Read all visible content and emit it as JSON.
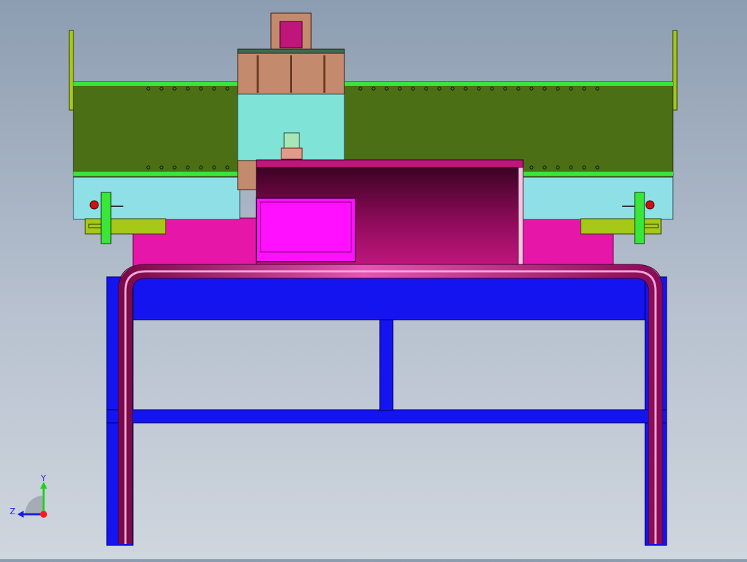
{
  "view": {
    "colors": {
      "background_top": "#8d9db1",
      "background_bottom": "#cfd6de",
      "frame_blue": "#1414f0",
      "guard_magenta": "#b0126e",
      "panel_pink": "#e617a8",
      "belt_green": "#4a6f14",
      "belt_edge": "#39e639",
      "cyan_plate": "#7fe3d7",
      "bracket_yellow_green": "#a6c817",
      "motor_brown": "#c48a6e"
    }
  },
  "triad": {
    "y_label": "Y",
    "z_label": "Z",
    "colors": {
      "y": "#1bd31b",
      "z": "#1a1ae6",
      "origin": "#ff1a1a"
    }
  }
}
